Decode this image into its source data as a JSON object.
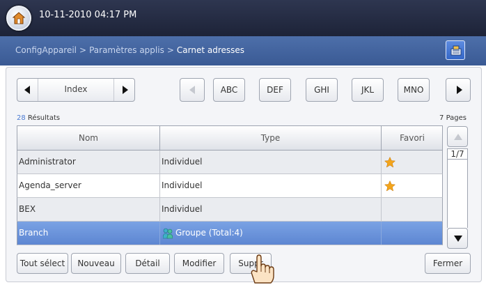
{
  "header": {
    "datetime": "10-11-2010 04:17 PM"
  },
  "breadcrumb": {
    "part1": "ConfigAppareil",
    "sep": ">",
    "part2": "Paramètres applis",
    "current": "Carnet adresses"
  },
  "index": {
    "label": "Index"
  },
  "alpha_tabs": [
    "ABC",
    "DEF",
    "GHI",
    "JKL",
    "MNO"
  ],
  "results": {
    "count": "28",
    "label": "Résultats",
    "pages": "7 Pages"
  },
  "table": {
    "columns": [
      "Nom",
      "Type",
      "Favori"
    ],
    "rows": [
      {
        "name": "Administrator",
        "type": "Individuel",
        "favorite": true
      },
      {
        "name": "Agenda_server",
        "type": "Individuel",
        "favorite": true
      },
      {
        "name": "BEX",
        "type": "Individuel",
        "favorite": false
      },
      {
        "name": "Branch",
        "type": "Groupe (Total:4)",
        "favorite": false,
        "selected": true
      }
    ]
  },
  "pagination": {
    "indicator": "1/7"
  },
  "actions": {
    "select_all": "Tout sélect",
    "new": "Nouveau",
    "detail": "Détail",
    "modify": "Modifier",
    "delete": "Suppr",
    "close": "Fermer"
  },
  "colors": {
    "topbar": "#1d2338",
    "crumbbar": "#3a5a94",
    "selected_row": "#5d86d2",
    "star": "#f3a51c"
  },
  "icons": {
    "home": "home-icon",
    "favorite": "star-icon",
    "group": "group-icon",
    "pointer": "hand-pointer-icon"
  }
}
